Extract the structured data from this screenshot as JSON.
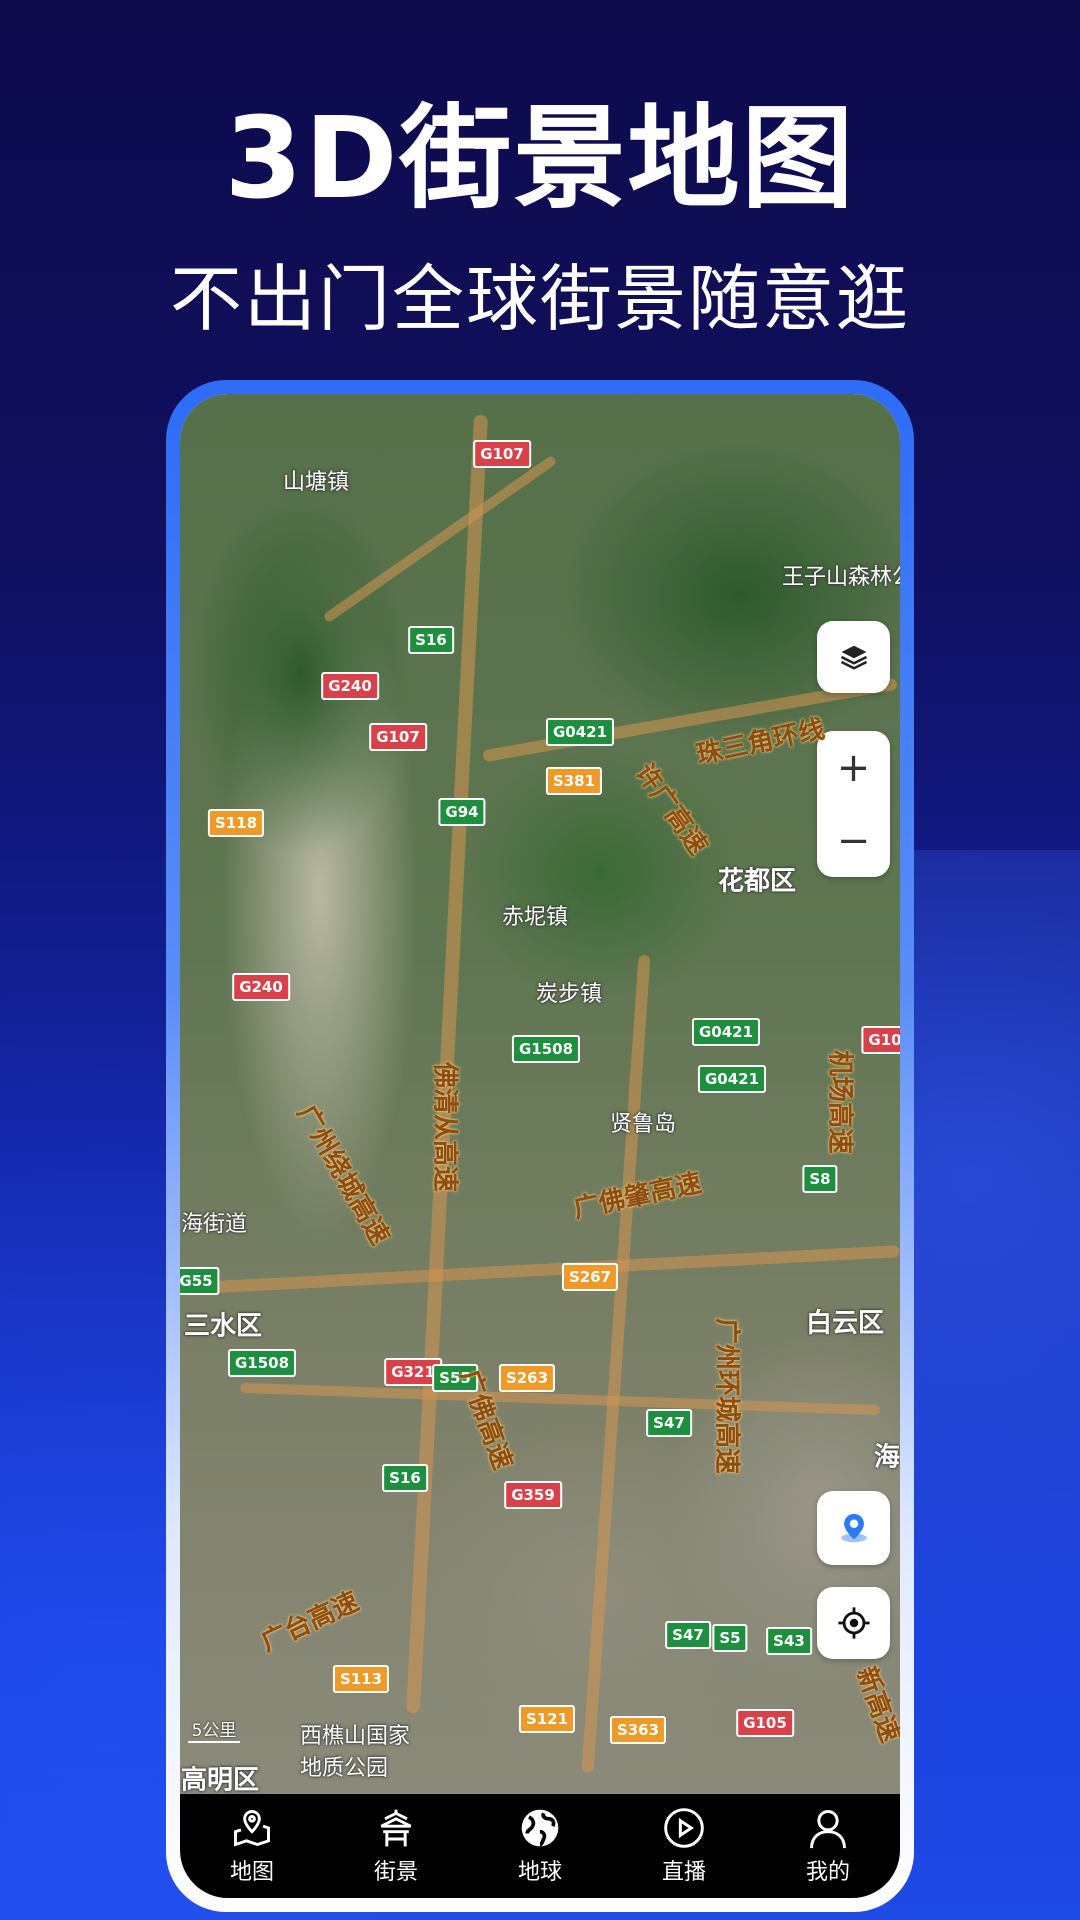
{
  "header": {
    "title": "3D街景地图",
    "subtitle": "不出门全球街景随意逛"
  },
  "map": {
    "labels": [
      {
        "text": "山塘镇",
        "type": "place"
      },
      {
        "text": "G107",
        "type": "s-red"
      },
      {
        "text": "王子山森林公",
        "type": "place"
      },
      {
        "text": "S16",
        "type": "s-green"
      },
      {
        "text": "G240",
        "type": "s-red"
      },
      {
        "text": "G107",
        "type": "s-red"
      },
      {
        "text": "G0421",
        "type": "s-green"
      },
      {
        "text": "S381",
        "type": "s-orange"
      },
      {
        "text": "珠三角环线",
        "type": "hw"
      },
      {
        "text": "许广高速",
        "type": "hw"
      },
      {
        "text": "S118",
        "type": "s-orange"
      },
      {
        "text": "G94",
        "type": "s-green"
      },
      {
        "text": "花都区",
        "type": "dist"
      },
      {
        "text": "赤坭镇",
        "type": "place"
      },
      {
        "text": "G240",
        "type": "s-red"
      },
      {
        "text": "炭步镇",
        "type": "place"
      },
      {
        "text": "G0421",
        "type": "s-green"
      },
      {
        "text": "G1508",
        "type": "s-green"
      },
      {
        "text": "G0421",
        "type": "s-green"
      },
      {
        "text": "G10",
        "type": "s-red"
      },
      {
        "text": "机场高速",
        "type": "hw"
      },
      {
        "text": "贤鲁岛",
        "type": "place"
      },
      {
        "text": "佛清从高速",
        "type": "hw"
      },
      {
        "text": "广州绕城高速",
        "type": "hw"
      },
      {
        "text": "S8",
        "type": "s-green"
      },
      {
        "text": "海街道",
        "type": "place"
      },
      {
        "text": "广佛肇高速",
        "type": "hw"
      },
      {
        "text": "G55",
        "type": "s-green"
      },
      {
        "text": "S267",
        "type": "s-orange"
      },
      {
        "text": "三水区",
        "type": "dist"
      },
      {
        "text": "白云区",
        "type": "dist"
      },
      {
        "text": "广州环城高速",
        "type": "hw"
      },
      {
        "text": "G1508",
        "type": "s-green"
      },
      {
        "text": "G321",
        "type": "s-red"
      },
      {
        "text": "S55",
        "type": "s-green"
      },
      {
        "text": "S263",
        "type": "s-orange"
      },
      {
        "text": "广佛高速",
        "type": "hw"
      },
      {
        "text": "S47",
        "type": "s-green"
      },
      {
        "text": "海",
        "type": "dist"
      },
      {
        "text": "S16",
        "type": "s-green"
      },
      {
        "text": "G359",
        "type": "s-red"
      },
      {
        "text": "广台高速",
        "type": "hw"
      },
      {
        "text": "S47",
        "type": "s-green"
      },
      {
        "text": "S5",
        "type": "s-green"
      },
      {
        "text": "S43",
        "type": "s-green"
      },
      {
        "text": "S113",
        "type": "s-orange"
      },
      {
        "text": "新高速",
        "type": "hw"
      },
      {
        "text": "S121",
        "type": "s-orange"
      },
      {
        "text": "S363",
        "type": "s-orange"
      },
      {
        "text": "G105",
        "type": "s-red"
      },
      {
        "text": "西樵山国家\n地质公园",
        "type": "place"
      },
      {
        "text": "高明区",
        "type": "dist"
      }
    ],
    "scale_label": "5公里",
    "controls": {
      "layers_icon": "layers-icon",
      "zoom_in": "+",
      "zoom_out": "−",
      "street_view_icon": "street-view-pin-icon",
      "locate_icon": "crosshair-icon"
    }
  },
  "nav": {
    "items": [
      {
        "label": "地图",
        "icon": "map-pin-icon"
      },
      {
        "label": "街景",
        "icon": "pavilion-icon"
      },
      {
        "label": "地球",
        "icon": "globe-icon"
      },
      {
        "label": "直播",
        "icon": "play-circle-icon"
      },
      {
        "label": "我的",
        "icon": "user-icon"
      }
    ]
  }
}
